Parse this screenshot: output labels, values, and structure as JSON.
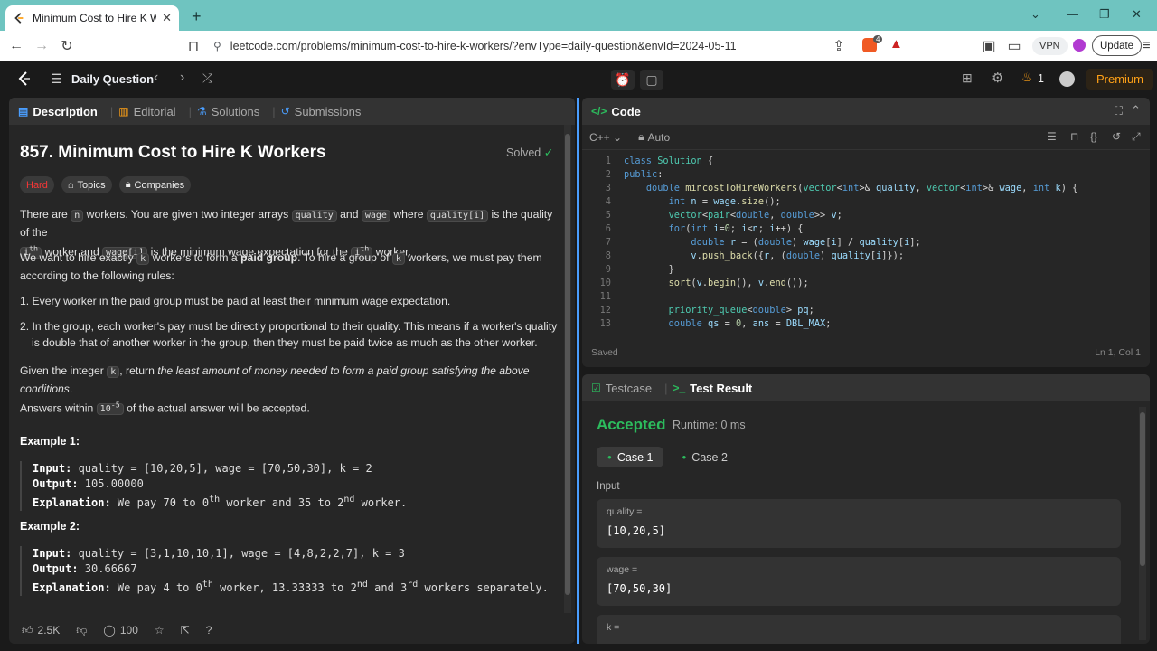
{
  "browser": {
    "tab_title": "Minimum Cost to Hire K Worker",
    "url": "leetcode.com/problems/minimum-cost-to-hire-k-workers/?envType=daily-question&envId=2024-05-11",
    "vpn_label": "VPN",
    "update_label": "Update",
    "brave_badge": "4"
  },
  "nav": {
    "daily_label": "Daily Question",
    "streak": "1",
    "premium_label": "Premium"
  },
  "desc_tabs": [
    "Description",
    "Editorial",
    "Solutions",
    "Submissions"
  ],
  "problem": {
    "title": "857. Minimum Cost to Hire K Workers",
    "solved_label": "Solved",
    "difficulty": "Hard",
    "topics_label": "Topics",
    "companies_label": "Companies",
    "p1_a": "There are ",
    "p1_n": "n",
    "p1_b": " workers. You are given two integer arrays ",
    "p1_q": "quality",
    "p1_and": " and ",
    "p1_w": "wage",
    "p1_where": " where ",
    "p1_qi": "quality[i]",
    "p1_c": " is the quality of the",
    "p1_ith": "i",
    "p1_th": "th",
    "p1_d": " worker and ",
    "p1_wi": "wage[i]",
    "p1_e": " is the minimum wage expectation for the ",
    "p1_f": " worker.",
    "p2_a": "We want to hire exactly ",
    "p2_k": "k",
    "p2_b": " workers to form a ",
    "p2_bold": "paid group",
    "p2_c": ". To hire a group of ",
    "p2_d": " workers, we must pay them according to the following rules:",
    "rule1": "1. Every worker in the paid group must be paid at least their minimum wage expectation.",
    "rule2a": "2. In the group, each worker's pay must be directly proportional to their quality. This means if a worker's quality",
    "rule2b": "is double that of another worker in the group, then they must be paid twice as much as the other worker.",
    "p3_a": "Given the integer ",
    "p3_b": ", return ",
    "p3_it": "the least amount of money needed to form a paid group satisfying the above conditions",
    "p3_c": ".",
    "p3_d": "Answers within ",
    "p3_pow": "10",
    "p3_exp": "-5",
    "p3_e": " of the actual answer will be accepted.",
    "ex1_title": "Example 1:",
    "ex1_input_label": "Input:",
    "ex1_input": " quality = [10,20,5], wage = [70,50,30], k = 2",
    "ex1_output_label": "Output:",
    "ex1_output": " 105.00000",
    "ex1_expl_label": "Explanation:",
    "ex1_expl_a": " We pay 70 to 0",
    "ex1_expl_b": " worker and 35 to 2",
    "ex1_expl_c": " worker.",
    "ex2_title": "Example 2:",
    "ex2_input": " quality = [3,1,10,10,1], wage = [4,8,2,2,7], k = 3",
    "ex2_output": " 30.66667",
    "ex2_expl_a": " We pay 4 to 0",
    "ex2_expl_b": " worker, 13.33333 to 2",
    "ex2_expl_c": " and 3",
    "ex2_expl_d": " workers separately.",
    "sup_th": "th",
    "sup_nd": "nd",
    "sup_rd": "rd",
    "likes": "2.5K",
    "comments": "100"
  },
  "code": {
    "header": "Code",
    "language": "C++",
    "mode": "Auto",
    "saved": "Saved",
    "cursor": "Ln 1, Col 1",
    "line_numbers": [
      "1",
      "2",
      "3",
      "4",
      "5",
      "6",
      "7",
      "8",
      "9",
      "10",
      "11",
      "12",
      "13"
    ]
  },
  "test": {
    "tab1": "Testcase",
    "tab2": "Test Result",
    "status": "Accepted",
    "runtime": "Runtime: 0 ms",
    "case1": "Case 1",
    "case2": "Case 2",
    "input_label": "Input",
    "var1_name": "quality =",
    "var1_value": "[10,20,5]",
    "var2_name": "wage =",
    "var2_value": "[70,50,30]",
    "var3_name": "k ="
  },
  "colors": {
    "accent": "#ffa116",
    "accepted": "#2cbb5d",
    "hard": "#f63737"
  }
}
